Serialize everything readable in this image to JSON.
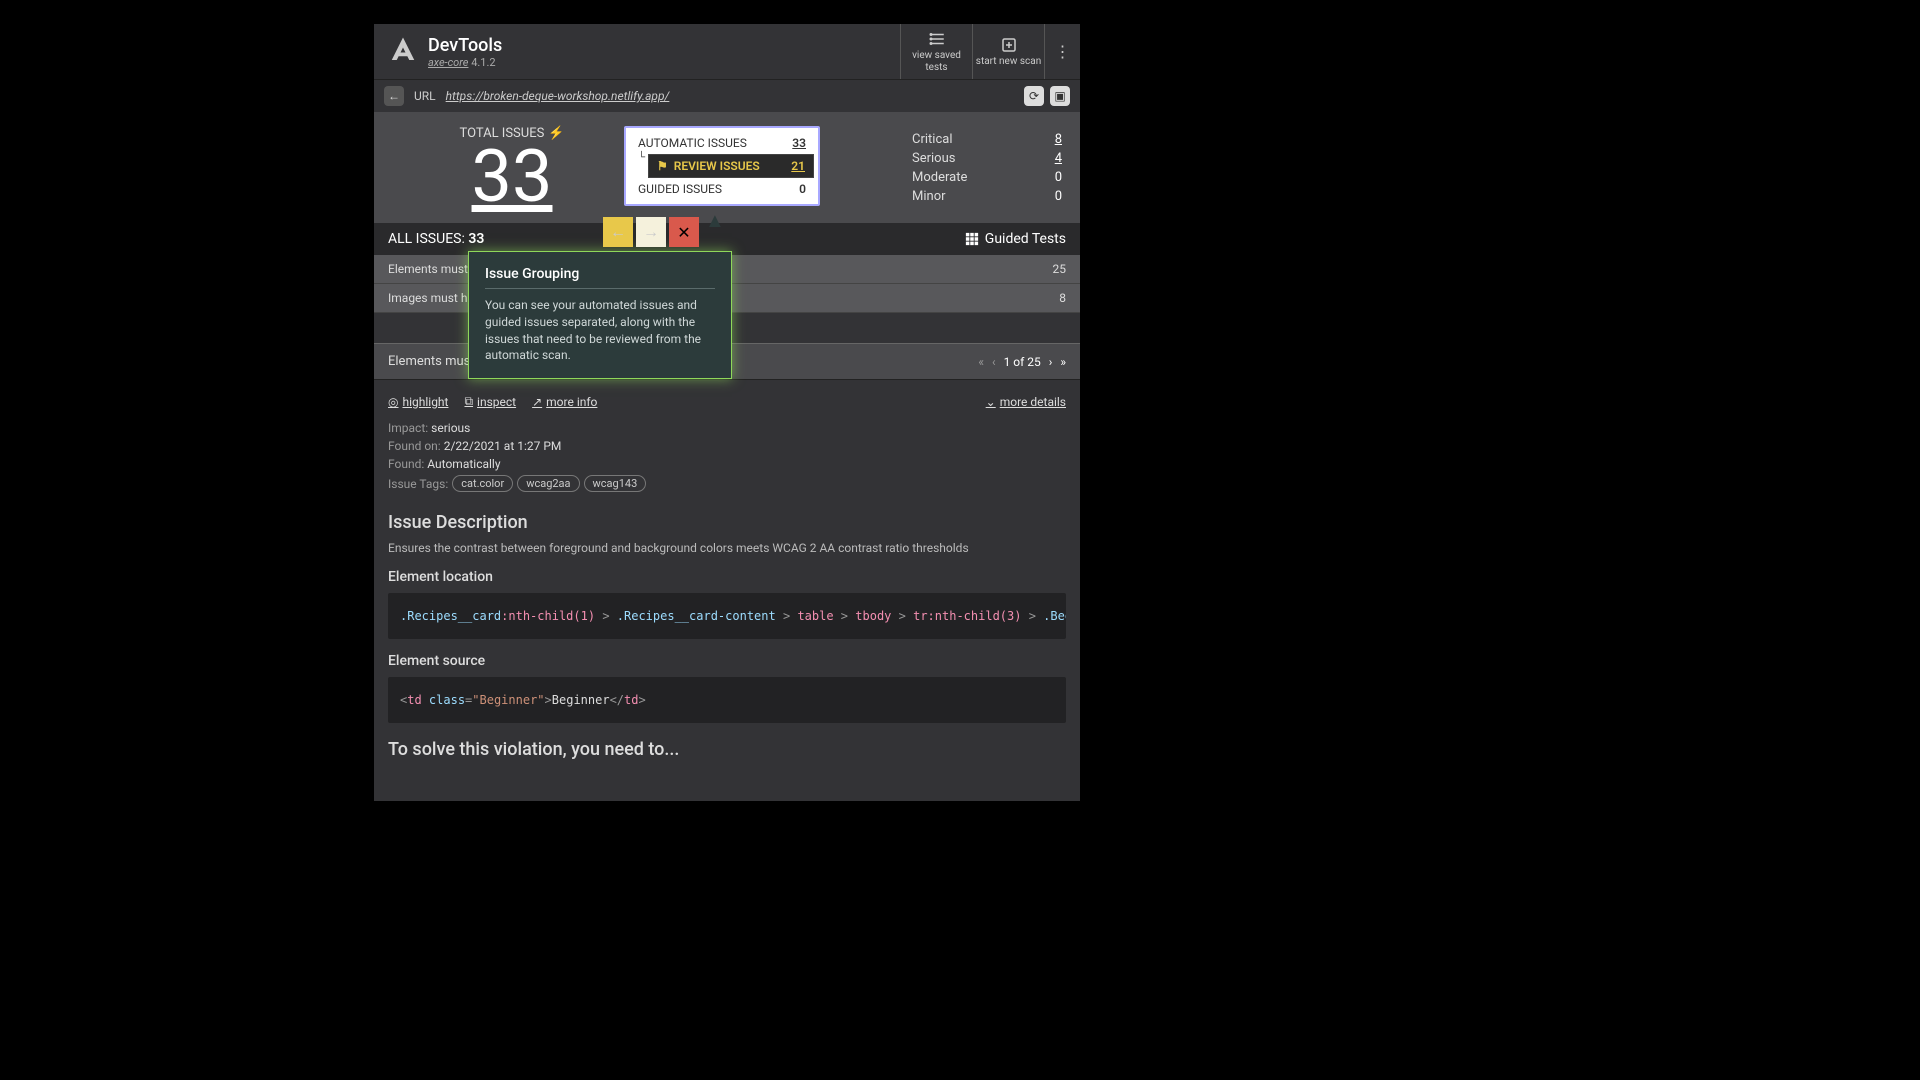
{
  "header": {
    "title": "DevTools",
    "product_link": "axe-core",
    "version": "4.1.2",
    "view_saved": "view saved tests",
    "start_new": "start new scan"
  },
  "url_bar": {
    "label": "URL",
    "url": "https://broken-deque-workshop.netlify.app/"
  },
  "summary": {
    "total_label": "TOTAL ISSUES",
    "total_count": "33",
    "groups": {
      "automatic_label": "AUTOMATIC ISSUES",
      "automatic_count": "33",
      "review_label": "REVIEW ISSUES",
      "review_count": "21",
      "guided_label": "GUIDED ISSUES",
      "guided_count": "0"
    },
    "severity": [
      {
        "label": "Critical",
        "count": "8",
        "zero": false
      },
      {
        "label": "Serious",
        "count": "4",
        "zero": false
      },
      {
        "label": "Moderate",
        "count": "0",
        "zero": true
      },
      {
        "label": "Minor",
        "count": "0",
        "zero": true
      }
    ]
  },
  "all_issues": {
    "label": "ALL ISSUES:",
    "count": "33",
    "guided_tests": "Guided Tests"
  },
  "issue_rows": [
    {
      "title": "Elements must have sufficient color contrast",
      "count": "25"
    },
    {
      "title": "Images must have alternate text",
      "count": "8"
    }
  ],
  "detail": {
    "header_title": "Elements must have sufficient color contrast",
    "pager_text": "1 of 25",
    "links": {
      "highlight": "highlight",
      "inspect": "inspect",
      "more_info": "more info",
      "more_details": "more details"
    },
    "meta": {
      "impact_label": "Impact:",
      "impact": "serious",
      "found_on_label": "Found on:",
      "found_on": "2/22/2021 at 1:27 PM",
      "found_label": "Found:",
      "found": "Automatically",
      "tags_label": "Issue Tags:"
    },
    "tags": [
      "cat.color",
      "wcag2aa",
      "wcag143"
    ],
    "description_h": "Issue Description",
    "description": "Ensures the contrast between foreground and background colors meets WCAG 2 AA contrast ratio thresholds",
    "location_h": "Element location",
    "source_h": "Element source",
    "solve_h": "To solve this violation, you need to..."
  },
  "code": {
    "location": {
      "p1": ".Recipes__card",
      "p2": ":nth-child(1)",
      "p3": ".Recipes__card-content",
      "p4": "table",
      "p5": "tbody",
      "p6": "tr",
      "p7": ":nth-child(3)",
      "p8": ".Beginner"
    },
    "source": {
      "tag": "td",
      "attr_name": "class",
      "attr_val": "\"Beginner\"",
      "text": "Beginner"
    }
  },
  "tour": {
    "title": "Issue Grouping",
    "text": "You can see your automated issues and guided issues separated, along with the issues that need to be reviewed from the automatic scan."
  }
}
